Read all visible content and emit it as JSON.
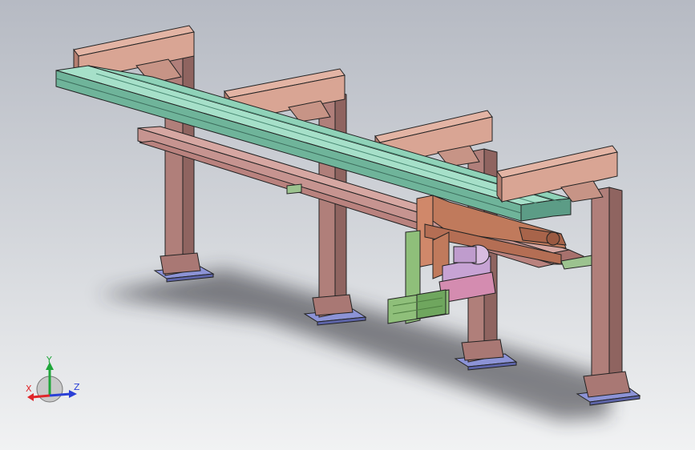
{
  "viewport": {
    "background_top": "#b6bac3",
    "background_bottom": "#f1f2f3"
  },
  "model": {
    "colors": {
      "rail_top": "#8fd2b8",
      "rail_side": "#5c9c86",
      "crossbeam": "#d9a594",
      "crossbeam_dark": "#b47e70",
      "column": "#b07f7a",
      "column_dark": "#8f6460",
      "base_plate": "#8c93d6",
      "lower_rail": "#c69490",
      "carriage": "#d0886a",
      "motor": "#c7a3d4",
      "green_bracket": "#8fbf7a",
      "outline": "#222222",
      "shadow": "#2a2c30"
    }
  },
  "triad": {
    "x_label": "X",
    "y_label": "Y",
    "z_label": "Z",
    "x_color": "#e0262a",
    "y_color": "#1fa63a",
    "z_color": "#2a3fd6"
  }
}
